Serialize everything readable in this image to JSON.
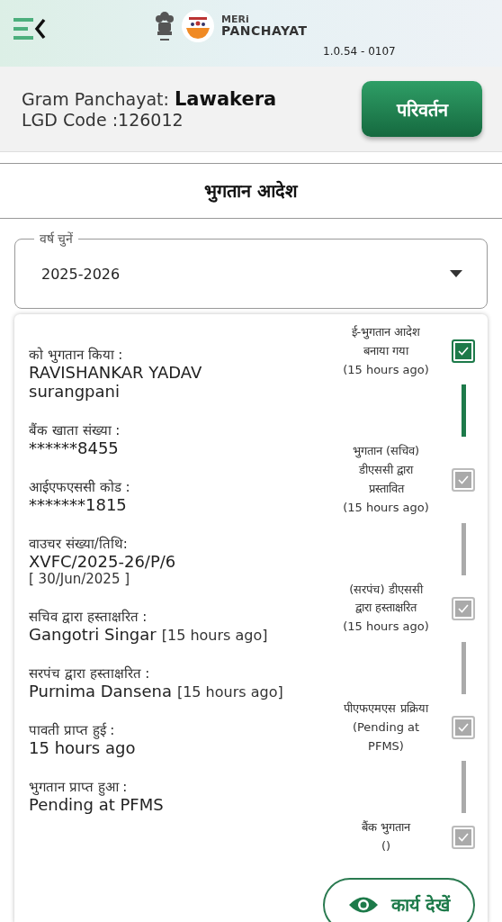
{
  "header": {
    "brand_top": "MERi",
    "brand_bottom": "PANCHAYAT",
    "version": "1.0.54 - 0107"
  },
  "panchayat": {
    "label": "Gram Panchayat:",
    "name": "Lawakera",
    "lgd": "LGD Code :126012",
    "change_button": "परिवर्तन"
  },
  "page_title": "भुगतान आदेश",
  "year_select": {
    "label": "वर्ष चुनें",
    "value": "2025-2026"
  },
  "fields": [
    {
      "label": "को भुगतान किया :",
      "lines": [
        "RAVISHANKAR YADAV",
        "surangpani"
      ]
    },
    {
      "label": "बैंक खाता संख्या :",
      "lines": [
        "******8455"
      ]
    },
    {
      "label": "आईएफएससी कोड :",
      "lines": [
        "*******1815"
      ]
    },
    {
      "label": "वाउचर संख्या/तिथि:",
      "lines": [
        "XVFC/2025-26/P/6"
      ],
      "note": "[ 30/Jun/2025 ]",
      "kind": "note-below"
    },
    {
      "label": "सचिव द्वारा हस्ताक्षरित :",
      "lines": [
        "Gangotri Singar"
      ],
      "note": "[15 hours ago]",
      "kind": "note-inline"
    },
    {
      "label": "सरपंच द्वारा हस्ताक्षरित :",
      "lines": [
        "Purnima Dansena"
      ],
      "note": "[15 hours ago]",
      "kind": "note-inline"
    },
    {
      "label": "पावती प्राप्त हुई :",
      "lines": [
        "15 hours ago"
      ]
    },
    {
      "label": "भुगतान प्राप्त हुआ :",
      "lines": [
        "Pending at PFMS"
      ]
    }
  ],
  "steps": [
    {
      "lines": [
        "ई-भुगतान आदेश",
        "बनाया गया",
        "(15 hours ago)"
      ],
      "checked": true,
      "disabled": false
    },
    {
      "lines": [
        "भुगतान (सचिव)",
        "डीएससी द्वारा",
        "प्रस्तावित",
        "(15 hours ago)"
      ],
      "checked": true,
      "disabled": true
    },
    {
      "lines": [
        "(सरपंच) डीएससी",
        "द्वारा हस्ताक्षरित",
        "(15 hours ago)"
      ],
      "checked": true,
      "disabled": true
    },
    {
      "lines": [
        "पीएफएमएस प्रक्रिया",
        "(Pending at",
        "PFMS)"
      ],
      "checked": true,
      "disabled": true
    },
    {
      "lines": [
        "बैंक भुगतान",
        "()"
      ],
      "checked": true,
      "disabled": true
    }
  ],
  "view_button": "कार्य देखें"
}
